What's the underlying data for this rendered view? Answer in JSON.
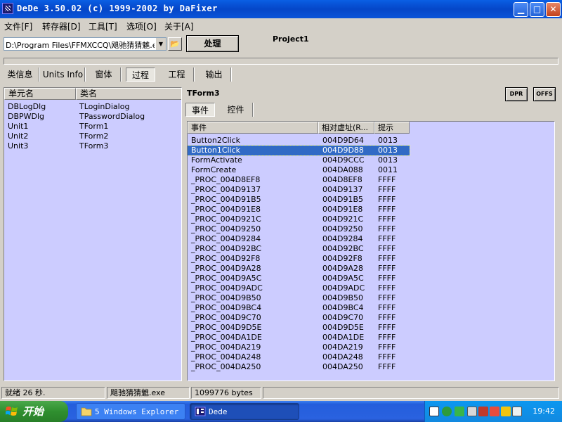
{
  "window": {
    "title": "DeDe 3.50.02 (c) 1999-2002 by DaFixer"
  },
  "menu": [
    "文件[F]",
    "转存器[D]",
    "工具[T]",
    "选项[O]",
    "关于[A]"
  ],
  "toolbar": {
    "file_path": "D:\\Program Files\\FFMXCCQ\\飓驰猜猜魋.exe",
    "process_label": "处理",
    "project_name": "Project1",
    "progress": 0
  },
  "main_tabs": [
    "类信息",
    "Units Info",
    "窗体",
    "过程",
    "工程",
    "输出"
  ],
  "main_tab_active": "过程",
  "units": {
    "headers": [
      "单元名",
      "类名"
    ],
    "rows": [
      [
        "DBLogDlg",
        "TLoginDialog"
      ],
      [
        "DBPWDlg",
        "TPasswordDialog"
      ],
      [
        "Unit1",
        "TForm1"
      ],
      [
        "Unit2",
        "TForm2"
      ],
      [
        "Unit3",
        "TForm3"
      ]
    ]
  },
  "form": {
    "name": "TForm3",
    "dpr_label": "DPR",
    "offs_label": "OFFS",
    "tabs": [
      "事件",
      "控件"
    ],
    "active_tab": "事件"
  },
  "events": {
    "headers": [
      "事件",
      "相对虚址(R...",
      "提示"
    ],
    "selected_index": 1,
    "rows": [
      [
        "Button2Click",
        "004D9D64",
        "0013"
      ],
      [
        "Button1Click",
        "004D9D88",
        "0013"
      ],
      [
        "FormActivate",
        "004D9CCC",
        "0013"
      ],
      [
        "FormCreate",
        "004DA088",
        "0011"
      ],
      [
        "_PROC_004D8EF8",
        "004D8EF8",
        "FFFF"
      ],
      [
        "_PROC_004D9137",
        "004D9137",
        "FFFF"
      ],
      [
        "_PROC_004D91B5",
        "004D91B5",
        "FFFF"
      ],
      [
        "_PROC_004D91E8",
        "004D91E8",
        "FFFF"
      ],
      [
        "_PROC_004D921C",
        "004D921C",
        "FFFF"
      ],
      [
        "_PROC_004D9250",
        "004D9250",
        "FFFF"
      ],
      [
        "_PROC_004D9284",
        "004D9284",
        "FFFF"
      ],
      [
        "_PROC_004D92BC",
        "004D92BC",
        "FFFF"
      ],
      [
        "_PROC_004D92F8",
        "004D92F8",
        "FFFF"
      ],
      [
        "_PROC_004D9A28",
        "004D9A28",
        "FFFF"
      ],
      [
        "_PROC_004D9A5C",
        "004D9A5C",
        "FFFF"
      ],
      [
        "_PROC_004D9ADC",
        "004D9ADC",
        "FFFF"
      ],
      [
        "_PROC_004D9B50",
        "004D9B50",
        "FFFF"
      ],
      [
        "_PROC_004D9BC4",
        "004D9BC4",
        "FFFF"
      ],
      [
        "_PROC_004D9C70",
        "004D9C70",
        "FFFF"
      ],
      [
        "_PROC_004D9D5E",
        "004D9D5E",
        "FFFF"
      ],
      [
        "_PROC_004DA1DE",
        "004DA1DE",
        "FFFF"
      ],
      [
        "_PROC_004DA219",
        "004DA219",
        "FFFF"
      ],
      [
        "_PROC_004DA248",
        "004DA248",
        "FFFF"
      ],
      [
        "_PROC_004DA250",
        "004DA250",
        "FFFF"
      ]
    ]
  },
  "status": {
    "time": "就绪 26 秒.",
    "file": "飓驰猜猜魋.exe",
    "size": "1099776 bytes"
  },
  "taskbar": {
    "start_label": "开始",
    "explorer_label": "5 Windows Explorer",
    "dede_label": "Dede",
    "clock": "19:42"
  },
  "colors": {
    "list_bg": "#ccccff",
    "selection": "#316ac5",
    "titlebar": "#0a5fe4",
    "taskbar": "#245edc",
    "start": "#2f8f2f"
  }
}
